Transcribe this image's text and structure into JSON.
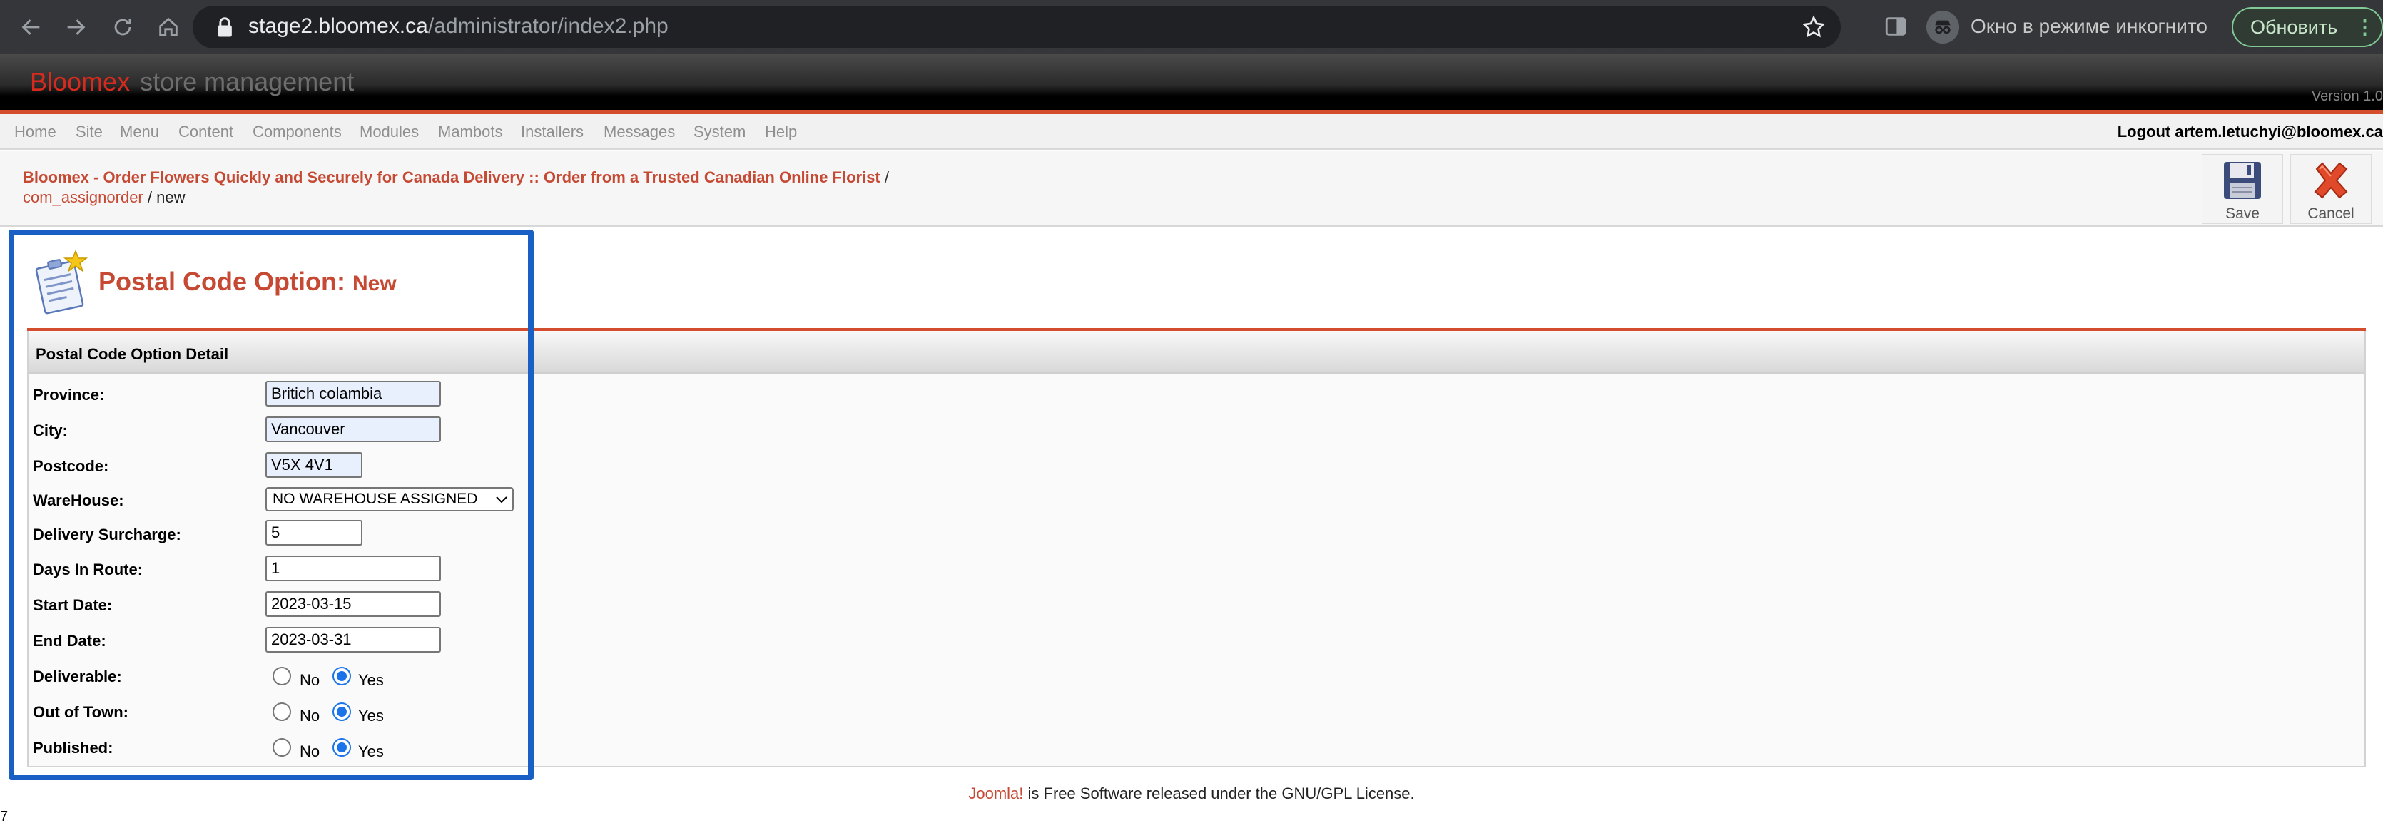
{
  "browser": {
    "url_host": "stage2.bloomex.ca",
    "url_path": "/administrator/index2.php",
    "incognito_text": "Окно в режиме инкогнито",
    "update_label": "Обновить"
  },
  "header": {
    "brand_name": "Bloomex",
    "brand_suffix": "store management",
    "version_text": "Version 1.0"
  },
  "menu": {
    "items": [
      "Home",
      "Site",
      "Menu",
      "Content",
      "Components",
      "Modules",
      "Mambots",
      "Installers",
      "Messages",
      "System",
      "Help"
    ],
    "logout_text": "Logout artem.letuchyi@bloomex.ca"
  },
  "pathway": {
    "site_title": "Bloomex - Order Flowers Quickly and Securely for Canada Delivery :: Order from a Trusted Canadian Online Florist",
    "separator": "/",
    "component": "com_assignorder",
    "current": "new"
  },
  "toolbar": {
    "save_label": "Save",
    "cancel_label": "Cancel"
  },
  "page": {
    "title": "Postal Code Option:",
    "title_suffix": "New",
    "panel_title": "Postal Code Option Detail"
  },
  "form": {
    "province_label": "Province:",
    "province_value": "Britich colambia",
    "city_label": "City:",
    "city_value": "Vancouver",
    "postcode_label": "Postcode:",
    "postcode_value": "V5X 4V1",
    "warehouse_label": "WareHouse:",
    "warehouse_value": "NO WAREHOUSE ASSIGNED",
    "surcharge_label": "Delivery Surcharge:",
    "surcharge_value": "5",
    "days_label": "Days In Route:",
    "days_value": "1",
    "start_label": "Start Date:",
    "start_value": "2023-03-15",
    "end_label": "End Date:",
    "end_value": "2023-03-31",
    "deliverable_label": "Deliverable:",
    "out_of_town_label": "Out of Town:",
    "published_label": "Published:",
    "no_label": "No",
    "yes_label": "Yes",
    "deliverable_selected": "Yes",
    "out_of_town_selected": "Yes",
    "published_selected": "Yes"
  },
  "footer": {
    "joomla_link": "Joomla!",
    "license_text": "is Free Software released under the GNU/GPL License."
  },
  "misc": {
    "corner_number": "7"
  },
  "colors": {
    "accent_red": "#c64934",
    "highlight_blue": "#1a5fc4",
    "radio_blue": "#1a73e8"
  }
}
